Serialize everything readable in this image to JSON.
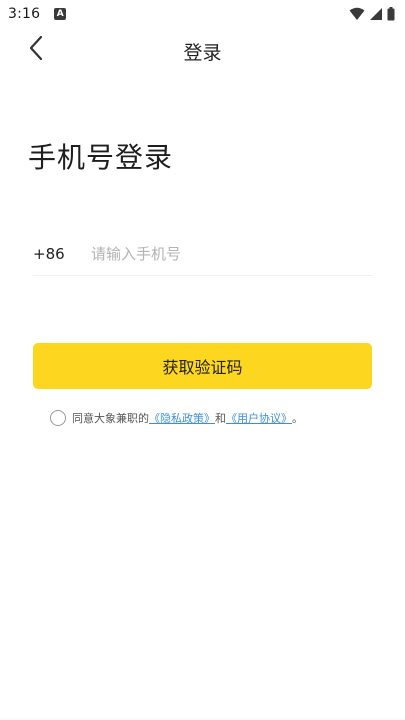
{
  "status_bar": {
    "time": "3:16",
    "notification_glyph": "A",
    "icons": [
      "wifi-icon",
      "signal-icon",
      "battery-icon"
    ]
  },
  "nav": {
    "title": "登录",
    "back_icon": "chevron-left-icon"
  },
  "main": {
    "heading": "手机号登录",
    "country_code": "+86",
    "phone_placeholder": "请输入手机号",
    "phone_value": "",
    "get_code_label": "获取验证码"
  },
  "agreement": {
    "checked": false,
    "prefix": "同意大象兼职的",
    "privacy_link": "《隐私政策》",
    "and": "和",
    "terms_link": "《用户协议》",
    "suffix": "。"
  },
  "colors": {
    "accent": "#fcd61f",
    "link": "#3b8fd6",
    "placeholder": "#b3b3b3"
  }
}
